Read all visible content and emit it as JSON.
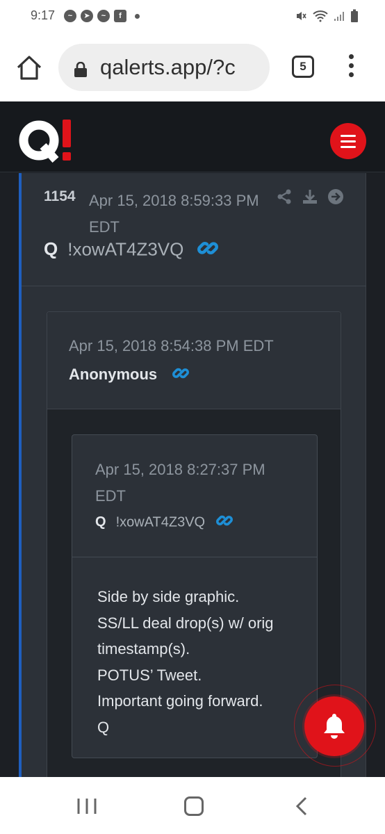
{
  "status_bar": {
    "time": "9:17",
    "notification_icons": [
      "messenger-icon",
      "telegram-icon",
      "messenger-icon",
      "facebook-icon",
      "dot-icon"
    ],
    "system_icons": [
      "mute-icon",
      "wifi-icon",
      "signal-icon",
      "battery-icon"
    ]
  },
  "browser": {
    "url": "qalerts.app/?c",
    "tab_count": "5"
  },
  "header": {
    "logo_text": "Q!",
    "accent_color": "#e0131a"
  },
  "post": {
    "number": "1154",
    "date": "Apr 15, 2018 8:59:33 PM EDT",
    "author_mark": "Q",
    "tripcode": "!xowAT4Z3VQ",
    "accent_color": "#1f5fbf",
    "actions": [
      "share-icon",
      "download-icon",
      "next-arrow-icon"
    ]
  },
  "quote": {
    "date": "Apr 15, 2018 8:54:38 PM EDT",
    "author": "Anonymous",
    "nested": {
      "date": "Apr 15, 2018 8:27:37 PM EDT",
      "author_mark": "Q",
      "tripcode": "!xowAT4Z3VQ",
      "lines": [
        "Side by side graphic.",
        "SS/LL deal drop(s) w/ orig",
        "timestamp(s).",
        "POTUS’ Tweet.",
        "Important going forward.",
        "Q"
      ]
    }
  },
  "link_color": "#1e8fd6",
  "fab": {
    "icon": "bell-icon"
  },
  "nav_bar": {
    "icons": [
      "recent-apps-icon",
      "home-icon",
      "back-icon"
    ]
  }
}
